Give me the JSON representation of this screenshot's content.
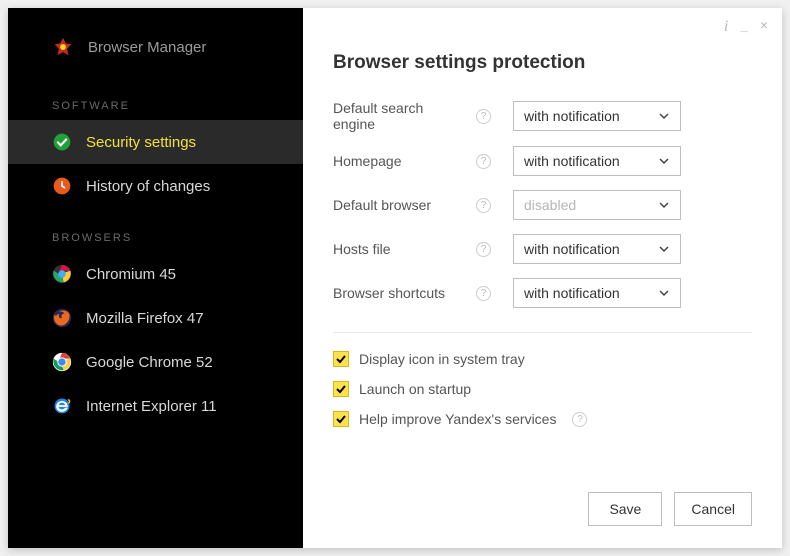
{
  "app": {
    "title": "Browser Manager"
  },
  "titlebar": {
    "info": "i",
    "minimize": "_",
    "close": "✕"
  },
  "sidebar": {
    "sections": {
      "software": {
        "label": "SOFTWARE"
      },
      "browsers": {
        "label": "BROWSERS"
      }
    },
    "nav": {
      "security": "Security settings",
      "history": "History of changes"
    },
    "browsers": {
      "chromium": "Chromium 45",
      "firefox": "Mozilla Firefox 47",
      "chrome": "Google Chrome 52",
      "ie": "Internet Explorer 11"
    }
  },
  "main": {
    "title": "Browser settings protection",
    "rows": {
      "search": {
        "label": "Default search engine",
        "value": "with notification"
      },
      "homepage": {
        "label": "Homepage",
        "value": "with notification"
      },
      "default_browser": {
        "label": "Default browser",
        "value": "disabled"
      },
      "hosts": {
        "label": "Hosts file",
        "value": "with notification"
      },
      "shortcuts": {
        "label": "Browser shortcuts",
        "value": "with notification"
      }
    },
    "checks": {
      "tray": "Display icon in system tray",
      "startup": "Launch on startup",
      "improve": "Help improve Yandex's services"
    },
    "buttons": {
      "save": "Save",
      "cancel": "Cancel"
    }
  }
}
